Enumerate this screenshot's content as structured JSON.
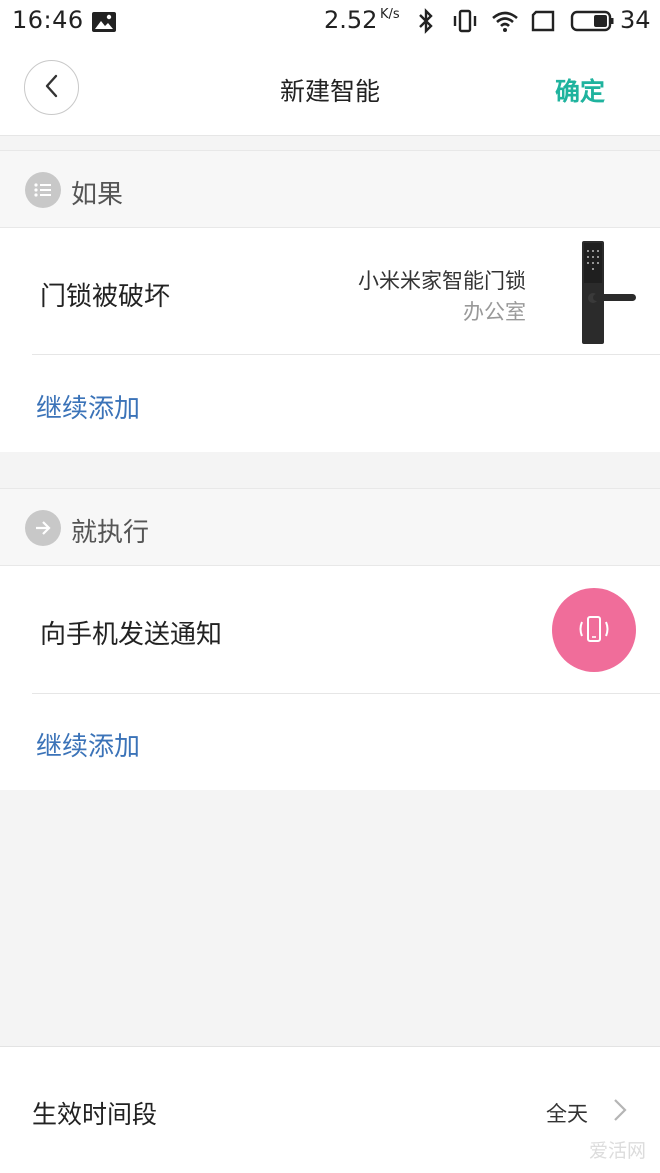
{
  "status_bar": {
    "time": "16:46",
    "net_speed": "2.52",
    "net_speed_unit": "K/s",
    "battery": "34",
    "icons": [
      "image-icon",
      "bluetooth-icon",
      "vibrate-icon",
      "wifi-icon",
      "screen-icon",
      "battery-icon"
    ]
  },
  "header": {
    "title": "新建智能",
    "confirm_label": "确定",
    "back_icon": "chevron-left-icon"
  },
  "if_section": {
    "title": "如果",
    "icon": "list-icon",
    "condition": "门锁被破坏",
    "device_name": "小米米家智能门锁",
    "device_room": "办公室",
    "add_more": "继续添加"
  },
  "then_section": {
    "title": "就执行",
    "icon": "arrow-right-icon",
    "action": "向手机发送通知",
    "action_icon": "phone-vibrate-icon",
    "add_more": "继续添加"
  },
  "bottom": {
    "label": "生效时间段",
    "value": "全天"
  },
  "watermark": "爱活网",
  "colors": {
    "accent": "#1fb39e",
    "link": "#3b73b8",
    "notify": "#f06d9a"
  }
}
